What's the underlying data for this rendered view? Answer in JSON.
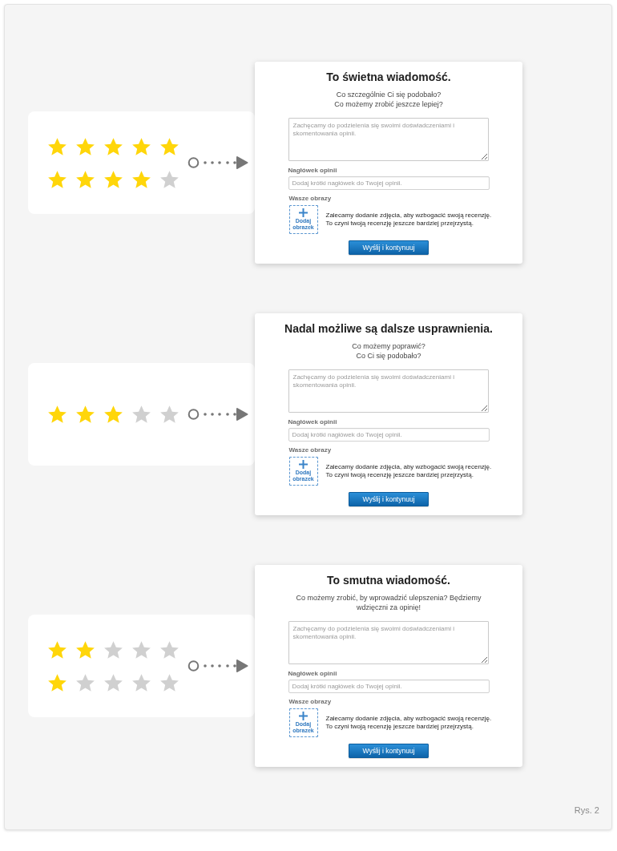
{
  "sections": [
    {
      "rating": {
        "rows": [
          {
            "stars": 5
          },
          {
            "stars": 4
          }
        ]
      },
      "card": {
        "title": "To świetna wiadomość.",
        "prompt": "Co szczególnie Ci się podobało?\nCo możemy zrobić jeszcze lepiej?",
        "comment_field": {
          "placeholder": "Zachęcamy do podzielenia się swoimi doświadczeniami i skomentowania opinii."
        },
        "headline_label": "Nagłówek opinii",
        "headline_field": {
          "placeholder": "Dodaj krótki nagłówek do Twojej opinii."
        },
        "images_label": "Wasze obrazy",
        "add_image_button": "Dodaj obrazek",
        "image_hint": "Zalecamy dodanie zdjęcia, aby wzbogacić swoją recenzję.\nTo czyni twoją recenzję jeszcze bardziej przejrzystą.",
        "submit_button": "Wyślij i kontynuuj"
      }
    },
    {
      "rating": {
        "rows": [
          {
            "stars": 3
          }
        ]
      },
      "card": {
        "title": "Nadal możliwe są dalsze usprawnienia.",
        "prompt": "Co możemy poprawić?\nCo Ci się podobało?",
        "comment_field": {
          "placeholder": "Zachęcamy do podzielenia się swoimi doświadczeniami i skomentowania opinii."
        },
        "headline_label": "Nagłówek opinii",
        "headline_field": {
          "placeholder": "Dodaj krótki nagłówek do Twojej opinii."
        },
        "images_label": "Wasze obrazy",
        "add_image_button": "Dodaj obrazek",
        "image_hint": "Zalecamy dodanie zdjęcia, aby wzbogacić swoją recenzję.\nTo czyni twoją recenzję jeszcze bardziej przejrzystą.",
        "submit_button": "Wyślij i kontynuuj"
      }
    },
    {
      "rating": {
        "rows": [
          {
            "stars": 2
          },
          {
            "stars": 1
          }
        ]
      },
      "card": {
        "title": "To smutna wiadomość.",
        "prompt": "Co możemy zrobić, by wprowadzić ulepszenia? Będziemy wdzięczni za opinię!",
        "comment_field": {
          "placeholder": "Zachęcamy do podzielenia się swoimi doświadczeniami i skomentowania opinii."
        },
        "headline_label": "Nagłówek opinii",
        "headline_field": {
          "placeholder": "Dodaj krótki nagłówek do Twojej opinii."
        },
        "images_label": "Wasze obrazy",
        "add_image_button": "Dodaj obrazek",
        "image_hint": "Zalecamy dodanie zdjęcia, aby wzbogacić swoją recenzję.\nTo czyni twoją recenzję jeszcze bardziej przejrzystą.",
        "submit_button": "Wyślij i kontynuuj"
      }
    }
  ],
  "caption": "Rys. 2"
}
